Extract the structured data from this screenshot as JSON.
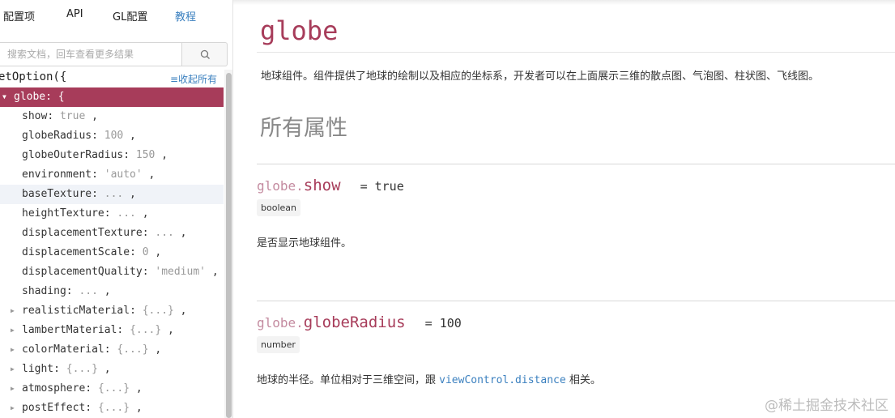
{
  "nav": {
    "tabs": [
      {
        "label": "配置项"
      },
      {
        "label": "API"
      },
      {
        "label": "GL配置"
      },
      {
        "label": "教程"
      }
    ]
  },
  "search": {
    "placeholder": "搜索文档，回车查看更多结果"
  },
  "tree": {
    "root_label": "etOption({",
    "collapse_label": "≡收起所有",
    "nodes": [
      {
        "key": "globe",
        "val": "{",
        "comma": ""
      },
      {
        "key": "show",
        "val": "true",
        "comma": " ,"
      },
      {
        "key": "globeRadius",
        "val": "100",
        "comma": " ,"
      },
      {
        "key": "globeOuterRadius",
        "val": "150",
        "comma": " ,"
      },
      {
        "key": "environment",
        "val": "'auto'",
        "comma": " ,"
      },
      {
        "key": "baseTexture",
        "val": "...",
        "comma": " ,"
      },
      {
        "key": "heightTexture",
        "val": "...",
        "comma": " ,"
      },
      {
        "key": "displacementTexture",
        "val": "...",
        "comma": " ,"
      },
      {
        "key": "displacementScale",
        "val": "0",
        "comma": " ,"
      },
      {
        "key": "displacementQuality",
        "val": "'medium'",
        "comma": " ,"
      },
      {
        "key": "shading",
        "val": "...",
        "comma": " ,"
      },
      {
        "key": "realisticMaterial",
        "val": "{...}",
        "comma": " ,"
      },
      {
        "key": "lambertMaterial",
        "val": "{...}",
        "comma": " ,"
      },
      {
        "key": "colorMaterial",
        "val": "{...}",
        "comma": " ,"
      },
      {
        "key": "light",
        "val": "{...}",
        "comma": " ,"
      },
      {
        "key": "atmosphere",
        "val": "{...}",
        "comma": " ,"
      },
      {
        "key": "postEffect",
        "val": "{...}",
        "comma": " ,"
      }
    ]
  },
  "page": {
    "title": "globe",
    "description": "地球组件。组件提供了地球的绘制以及相应的坐标系，开发者可以在上面展示三维的散点图、气泡图、柱状图、飞线图。",
    "section_heading": "所有属性"
  },
  "properties": [
    {
      "prefix": "globe.",
      "name": "show",
      "default": "= true",
      "type": "boolean",
      "description": "是否显示地球组件。"
    },
    {
      "prefix": "globe.",
      "name": "globeRadius",
      "default": "= 100",
      "type": "number",
      "description_before": "地球的半径。单位相对于三维空间，跟 ",
      "description_link": "viewControl.distance",
      "description_after": " 相关。"
    }
  ],
  "watermark": "@稀土掘金技术社区",
  "colors": {
    "accent": "#a73c5a",
    "link": "#3b80bf"
  }
}
